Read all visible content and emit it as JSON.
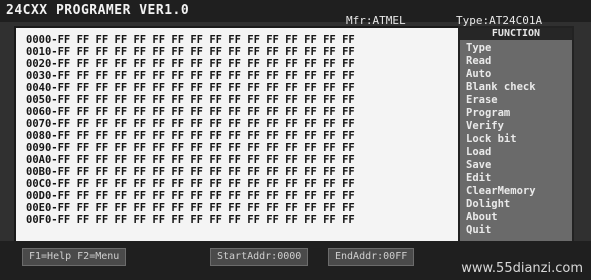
{
  "header": {
    "title": "24CXX PROGRAMER VER1.0",
    "manufacturer": "Mfr:ATMEL",
    "type": "Type:AT24C01A"
  },
  "dump": {
    "rows": [
      "0000-FF FF FF FF FF FF FF FF FF FF FF FF FF FF FF FF",
      "0010-FF FF FF FF FF FF FF FF FF FF FF FF FF FF FF FF",
      "0020-FF FF FF FF FF FF FF FF FF FF FF FF FF FF FF FF",
      "0030-FF FF FF FF FF FF FF FF FF FF FF FF FF FF FF FF",
      "0040-FF FF FF FF FF FF FF FF FF FF FF FF FF FF FF FF",
      "0050-FF FF FF FF FF FF FF FF FF FF FF FF FF FF FF FF",
      "0060-FF FF FF FF FF FF FF FF FF FF FF FF FF FF FF FF",
      "0070-FF FF FF FF FF FF FF FF FF FF FF FF FF FF FF FF",
      "0080-FF FF FF FF FF FF FF FF FF FF FF FF FF FF FF FF",
      "0090-FF FF FF FF FF FF FF FF FF FF FF FF FF FF FF FF",
      "00A0-FF FF FF FF FF FF FF FF FF FF FF FF FF FF FF FF",
      "00B0-FF FF FF FF FF FF FF FF FF FF FF FF FF FF FF FF",
      "00C0-FF FF FF FF FF FF FF FF FF FF FF FF FF FF FF FF",
      "00D0-FF FF FF FF FF FF FF FF FF FF FF FF FF FF FF FF",
      "00E0-FF FF FF FF FF FF FF FF FF FF FF FF FF FF FF FF",
      "00F0-FF FF FF FF FF FF FF FF FF FF FF FF FF FF FF FF"
    ]
  },
  "menu": {
    "title": "FUNCTION",
    "items": [
      "Type",
      "Read",
      "Auto",
      "Blank check",
      "Erase",
      "Program",
      "Verify",
      "Lock bit",
      "Load",
      "Save",
      "Edit",
      "ClearMemory",
      "Dolight",
      "About",
      "Quit"
    ]
  },
  "status": {
    "left": "F1=Help  F2=Menu",
    "start_addr": "StartAddr:0000",
    "end_addr": "EndAddr:00FF"
  },
  "watermark": "www.55dianzi.com"
}
